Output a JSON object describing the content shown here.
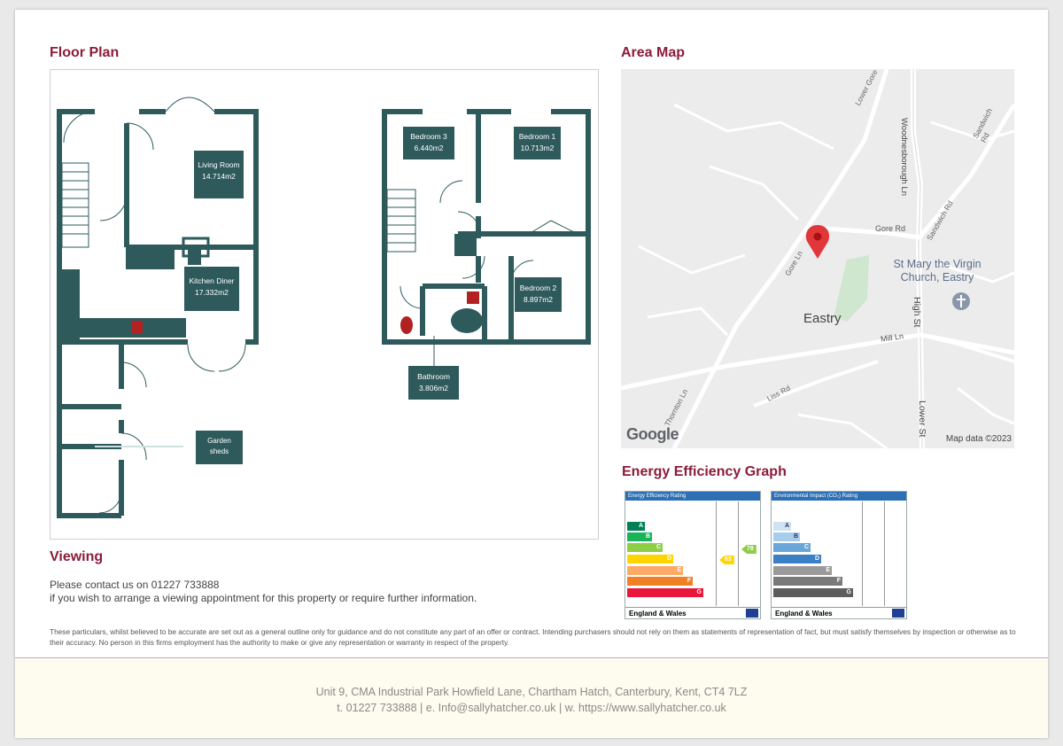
{
  "sections": {
    "floor_plan": "Floor Plan",
    "area_map": "Area Map",
    "energy": "Energy Efficiency Graph",
    "viewing": "Viewing"
  },
  "rooms": {
    "living": {
      "name": "Living Room",
      "area": "14.714m2"
    },
    "kitchen": {
      "name": "Kitchen Diner",
      "area": "17.332m2"
    },
    "sheds": {
      "name": "Garden",
      "name2": "sheds"
    },
    "bed3": {
      "name": "Bedroom 3",
      "area": "6.440m2"
    },
    "bed1": {
      "name": "Bedroom 1",
      "area": "10.713m2"
    },
    "bed2": {
      "name": "Bedroom 2",
      "area": "8.897m2"
    },
    "bath": {
      "name": "Bathroom",
      "area": "3.806m2"
    }
  },
  "map": {
    "labels": {
      "lower_gore": "Lower Gore Ln",
      "woodnesborough": "Woodnesborough Ln",
      "sandwich_rd_top": "Sandwich Rd",
      "sandwich_rd": "Sandwich Rd",
      "gore_rd": "Gore Rd",
      "gore_ln": "Gore Ln",
      "church1": "St Mary the Virgin",
      "church2": "Church, Eastry",
      "high_st": "High St",
      "eastry": "Eastry",
      "mill_ln": "Mill Ln",
      "liss_rd": "Liss Rd",
      "thornton": "Thornton Ln",
      "lower_st": "Lower St"
    },
    "google": "Google",
    "attribution": "Map data ©2023"
  },
  "epc": {
    "ee_title": "Energy Efficiency Rating",
    "ei_title": "Environmental Impact (CO₂) Rating",
    "region": "England & Wales",
    "current_ee": 63,
    "potential_ee": 78,
    "colors": {
      "A": "#008054",
      "B": "#19b459",
      "C": "#8dce46",
      "D": "#ffd500",
      "E": "#fcaa65",
      "F": "#ef8023",
      "G": "#e9153b",
      "ei_A": "#cfe3f3",
      "ei_B": "#a8cdec",
      "ei_C": "#6aa6d9",
      "ei_D": "#3d7fc4",
      "ei_E": "#9a9a9a",
      "ei_F": "#7a7a7a",
      "ei_G": "#5d5d5d"
    }
  },
  "viewing": {
    "line1": "Please contact us on 01227 733888",
    "line2": "if you wish to arrange a viewing appointment for this property or require further information."
  },
  "disclaimer": "These particulars, whilst believed to be accurate are set out as a general outline only for guidance and do not constitute any part of an offer or contract. Intending purchasers should not rely on them as statements of representation of fact, but must satisfy themselves by inspection or otherwise as to their accuracy. No person in this firms employment has the authority to make or give any representation or warranty in respect of the property.",
  "footer": {
    "address": "Unit 9, CMA Industrial Park Howfield Lane, Chartham Hatch, Canterbury, Kent, CT4 7LZ",
    "contact": "t. 01227 733888  |  e. Info@sallyhatcher.co.uk  |  w. https://www.sallyhatcher.co.uk"
  }
}
